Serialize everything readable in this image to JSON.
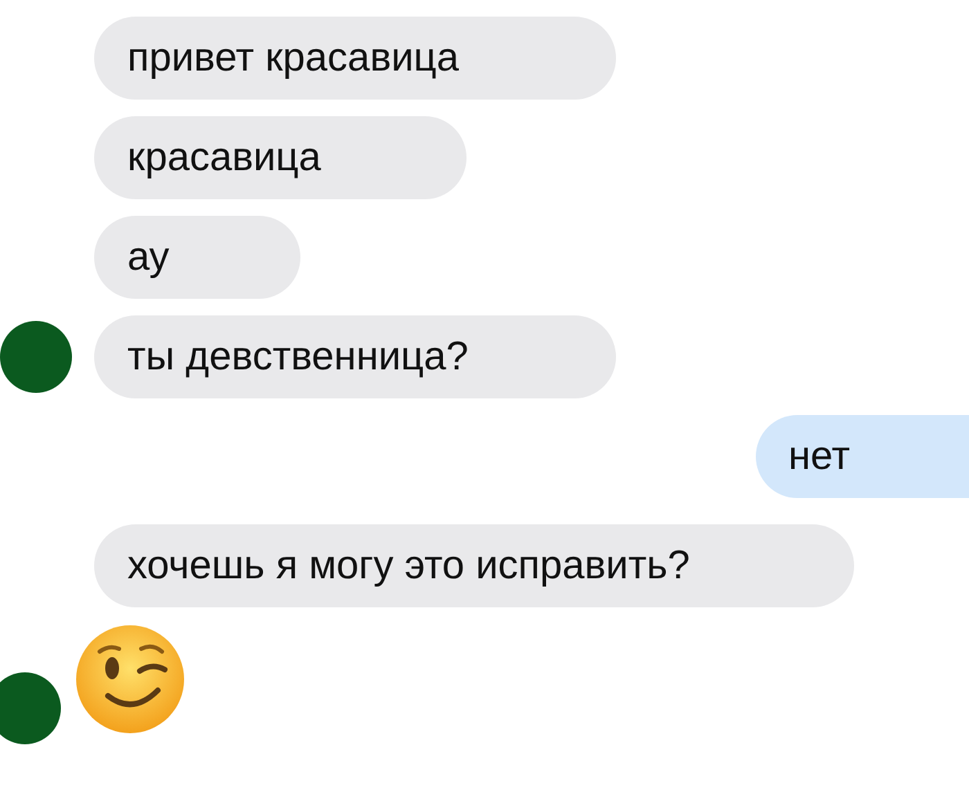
{
  "messages": [
    {
      "kind": "text",
      "outgoing": false,
      "avatar": false,
      "text": "привет красавица"
    },
    {
      "kind": "text",
      "outgoing": false,
      "avatar": false,
      "text": "красавица"
    },
    {
      "kind": "text",
      "outgoing": false,
      "avatar": false,
      "text": "ау"
    },
    {
      "kind": "text",
      "outgoing": false,
      "avatar": true,
      "text": "ты девственница?"
    },
    {
      "kind": "text",
      "outgoing": true,
      "avatar": false,
      "text": "нет"
    },
    {
      "kind": "text",
      "outgoing": false,
      "avatar": false,
      "text": "хочешь я могу это исправить?"
    },
    {
      "kind": "emoji",
      "outgoing": false,
      "avatar": true
    }
  ]
}
